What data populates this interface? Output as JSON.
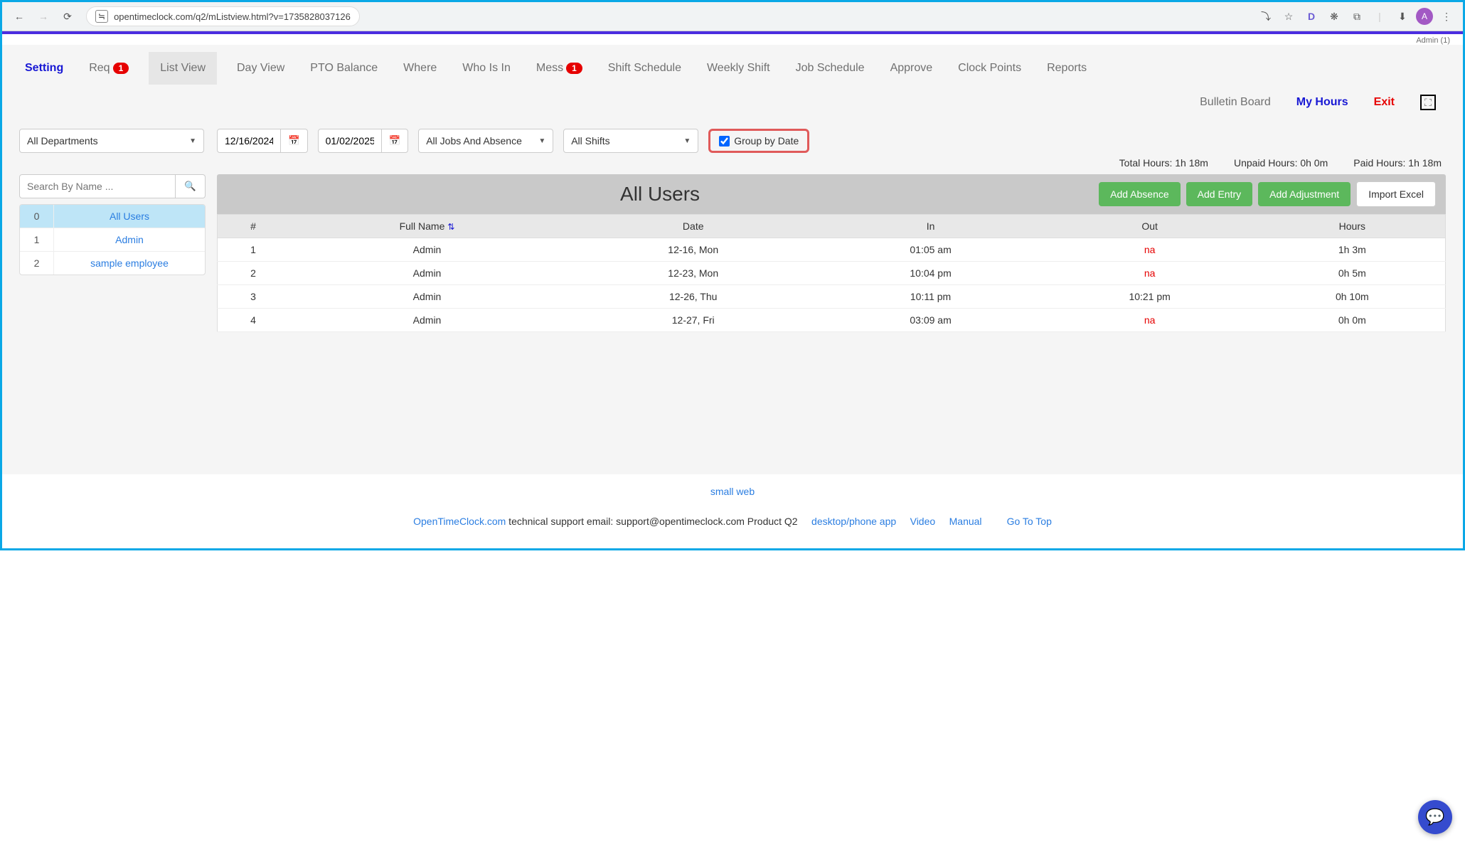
{
  "browser": {
    "url": "opentimeclock.com/q2/mListview.html?v=1735828037126",
    "avatar_letter": "A",
    "ext1": "D"
  },
  "admin_label": "Admin (1)",
  "nav": {
    "items": [
      {
        "label": "Setting",
        "cls": "blue"
      },
      {
        "label": "Req",
        "badge": "1"
      },
      {
        "label": "List View",
        "cls": "active"
      },
      {
        "label": "Day View"
      },
      {
        "label": "PTO Balance"
      },
      {
        "label": "Where"
      },
      {
        "label": "Who Is In"
      },
      {
        "label": "Mess",
        "badge": "1"
      },
      {
        "label": "Shift Schedule"
      },
      {
        "label": "Weekly Shift"
      },
      {
        "label": "Job Schedule"
      },
      {
        "label": "Approve"
      },
      {
        "label": "Clock Points"
      },
      {
        "label": "Reports"
      }
    ],
    "row2": [
      {
        "label": "Bulletin Board"
      },
      {
        "label": "My Hours",
        "cls": "bluelink"
      },
      {
        "label": "Exit",
        "cls": "red"
      }
    ]
  },
  "filters": {
    "department": "All Departments",
    "date_from": "12/16/2024",
    "date_to": "01/02/2025",
    "jobs": "All Jobs And Absence",
    "shifts": "All Shifts",
    "group_by_date_label": "Group by Date",
    "group_by_date_checked": true
  },
  "totals": {
    "total": "Total Hours: 1h 18m",
    "unpaid": "Unpaid Hours: 0h 0m",
    "paid": "Paid Hours: 1h 18m"
  },
  "sidebar": {
    "search_placeholder": "Search By Name ...",
    "users": [
      {
        "idx": "0",
        "name": "All Users",
        "selected": true
      },
      {
        "idx": "1",
        "name": "Admin"
      },
      {
        "idx": "2",
        "name": "sample employee"
      }
    ]
  },
  "main": {
    "title": "All Users",
    "buttons": {
      "add_absence": "Add Absence",
      "add_entry": "Add Entry",
      "add_adjustment": "Add Adjustment",
      "import_excel": "Import Excel"
    },
    "columns": [
      "#",
      "Full Name",
      "Date",
      "In",
      "Out",
      "Hours"
    ],
    "rows": [
      {
        "n": "1",
        "name": "Admin",
        "date": "12-16, Mon",
        "in": "01:05 am",
        "out": "na",
        "hours": "1h 3m"
      },
      {
        "n": "2",
        "name": "Admin",
        "date": "12-23, Mon",
        "in": "10:04 pm",
        "out": "na",
        "hours": "0h 5m"
      },
      {
        "n": "3",
        "name": "Admin",
        "date": "12-26, Thu",
        "in": "10:11 pm",
        "out": "10:21 pm",
        "hours": "0h 10m"
      },
      {
        "n": "4",
        "name": "Admin",
        "date": "12-27, Fri",
        "in": "03:09 am",
        "out": "na",
        "hours": "0h 0m"
      }
    ]
  },
  "small_web": "small web",
  "footer": {
    "otc": "OpenTimeClock.com",
    "support": " technical support email: support@opentimeclock.com Product Q2",
    "desktop": "desktop/phone app",
    "video": "Video",
    "manual": "Manual",
    "gototop": "Go To Top"
  }
}
